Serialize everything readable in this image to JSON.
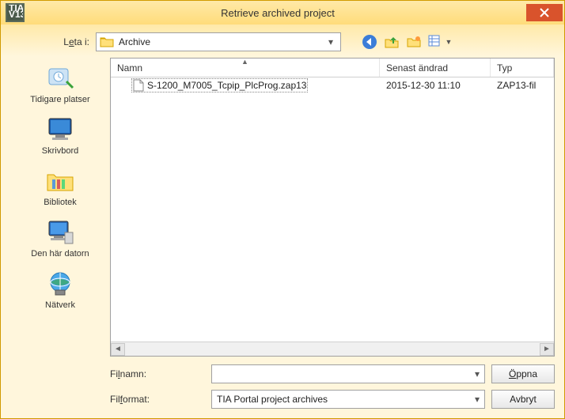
{
  "title": "Retrieve archived project",
  "lookin": {
    "label": "Leta i:",
    "value": "Archive"
  },
  "toolbar": {
    "back": "back-icon",
    "up": "up-icon",
    "newfolder": "new-folder-icon",
    "views": "views-icon"
  },
  "places": [
    {
      "label": "Tidigare platser"
    },
    {
      "label": "Skrivbord"
    },
    {
      "label": "Bibliotek"
    },
    {
      "label": "Den här datorn"
    },
    {
      "label": "Nätverk"
    }
  ],
  "columns": {
    "name": "Namn",
    "date": "Senast ändrad",
    "type": "Typ"
  },
  "rows": [
    {
      "name": "S-1200_M7005_Tcpip_PlcProg.zap13",
      "date": "2015-12-30 11:10",
      "type": "ZAP13-fil"
    }
  ],
  "filename": {
    "label": "Filnamn:",
    "value": ""
  },
  "fileformat": {
    "label": "Filformat:",
    "value": "TIA Portal project archives"
  },
  "buttons": {
    "open": "Öppna",
    "cancel": "Avbryt"
  }
}
